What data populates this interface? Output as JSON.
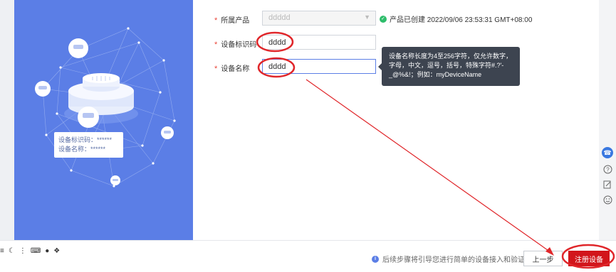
{
  "form": {
    "product": {
      "label": "所属产品",
      "value": "ddddd",
      "status": "产品已创建 2022/09/06 23:53:31 GMT+08:00"
    },
    "identifier": {
      "label": "设备标识码",
      "value": "dddd"
    },
    "device_name": {
      "label": "设备名称",
      "value": "dddd"
    }
  },
  "tooltip": {
    "line1": "设备名称长度为4至256字符，仅允许数字，",
    "line2": "字母，中文，逗号，括号，特殊字符#.?'-",
    "line3": "_@%&!；例如：myDeviceName"
  },
  "illustration_card": {
    "line1": "设备标识码：******",
    "line2": "设备名称：******"
  },
  "footer": {
    "hint": "后续步骤将引导您进行简单的设备接入和验证",
    "prev_label": "上一步",
    "register_label": "注册设备"
  },
  "toolbar_icons": [
    "menu-icon",
    "moon-icon",
    "dots-icon",
    "keyboard-icon",
    "user-icon",
    "grid-icon"
  ],
  "right_rail_icons": [
    "headset-icon",
    "help-icon",
    "edit-icon",
    "smile-icon"
  ],
  "colors": {
    "accent": "#5b7ee6",
    "primary_red": "#d2151b",
    "annotation_red": "#e0262a",
    "success": "#2ebd6b"
  }
}
